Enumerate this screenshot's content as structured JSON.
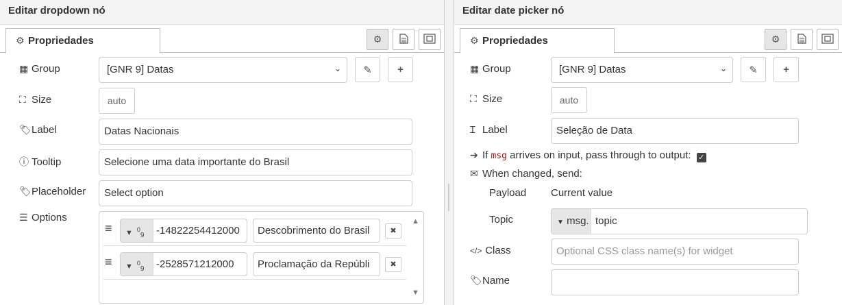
{
  "left": {
    "title": "Editar dropdown nó",
    "tab": "Propriedades",
    "fields": {
      "group_label": "Group",
      "group_value": "[GNR 9] Datas",
      "size_label": "Size",
      "size_value": "auto",
      "label_label": "Label",
      "label_value": "Datas Nacionais",
      "tooltip_label": "Tooltip",
      "tooltip_value": "Selecione uma data importante do Brasil",
      "placeholder_label": "Placeholder",
      "placeholder_value": "Select option",
      "options_label": "Options"
    },
    "options": [
      {
        "value": "-14822254412000",
        "label": "Descobrimento do Brasil"
      },
      {
        "value": "-2528571212000",
        "label": "Proclamação da Repúbli"
      }
    ]
  },
  "right": {
    "title": "Editar date picker nó",
    "tab": "Propriedades",
    "fields": {
      "group_label": "Group",
      "group_value": "[GNR 9] Datas",
      "size_label": "Size",
      "size_value": "auto",
      "label_label": "Label",
      "label_value": "Seleção de Data",
      "passthru_prefix": "If",
      "passthru_code": "msg",
      "passthru_suffix": "arrives on input, pass through to output:",
      "passthru_checked": true,
      "when_changed": "When changed, send:",
      "payload_label": "Payload",
      "payload_value": "Current value",
      "topic_label": "Topic",
      "topic_type": "msg.",
      "topic_value": "topic",
      "class_label": "Class",
      "class_placeholder": "Optional CSS class name(s) for widget",
      "name_label": "Name",
      "name_value": ""
    }
  },
  "icons": [
    "gear-icon",
    "document-icon",
    "frame-icon",
    "table-icon",
    "resize-icon",
    "tag-icon",
    "info-icon",
    "list-icon",
    "pencil-icon",
    "plus-icon",
    "arrow-right-icon",
    "envelope-icon",
    "code-icon",
    "text-cursor-icon",
    "drag-handle-icon",
    "remove-icon"
  ]
}
